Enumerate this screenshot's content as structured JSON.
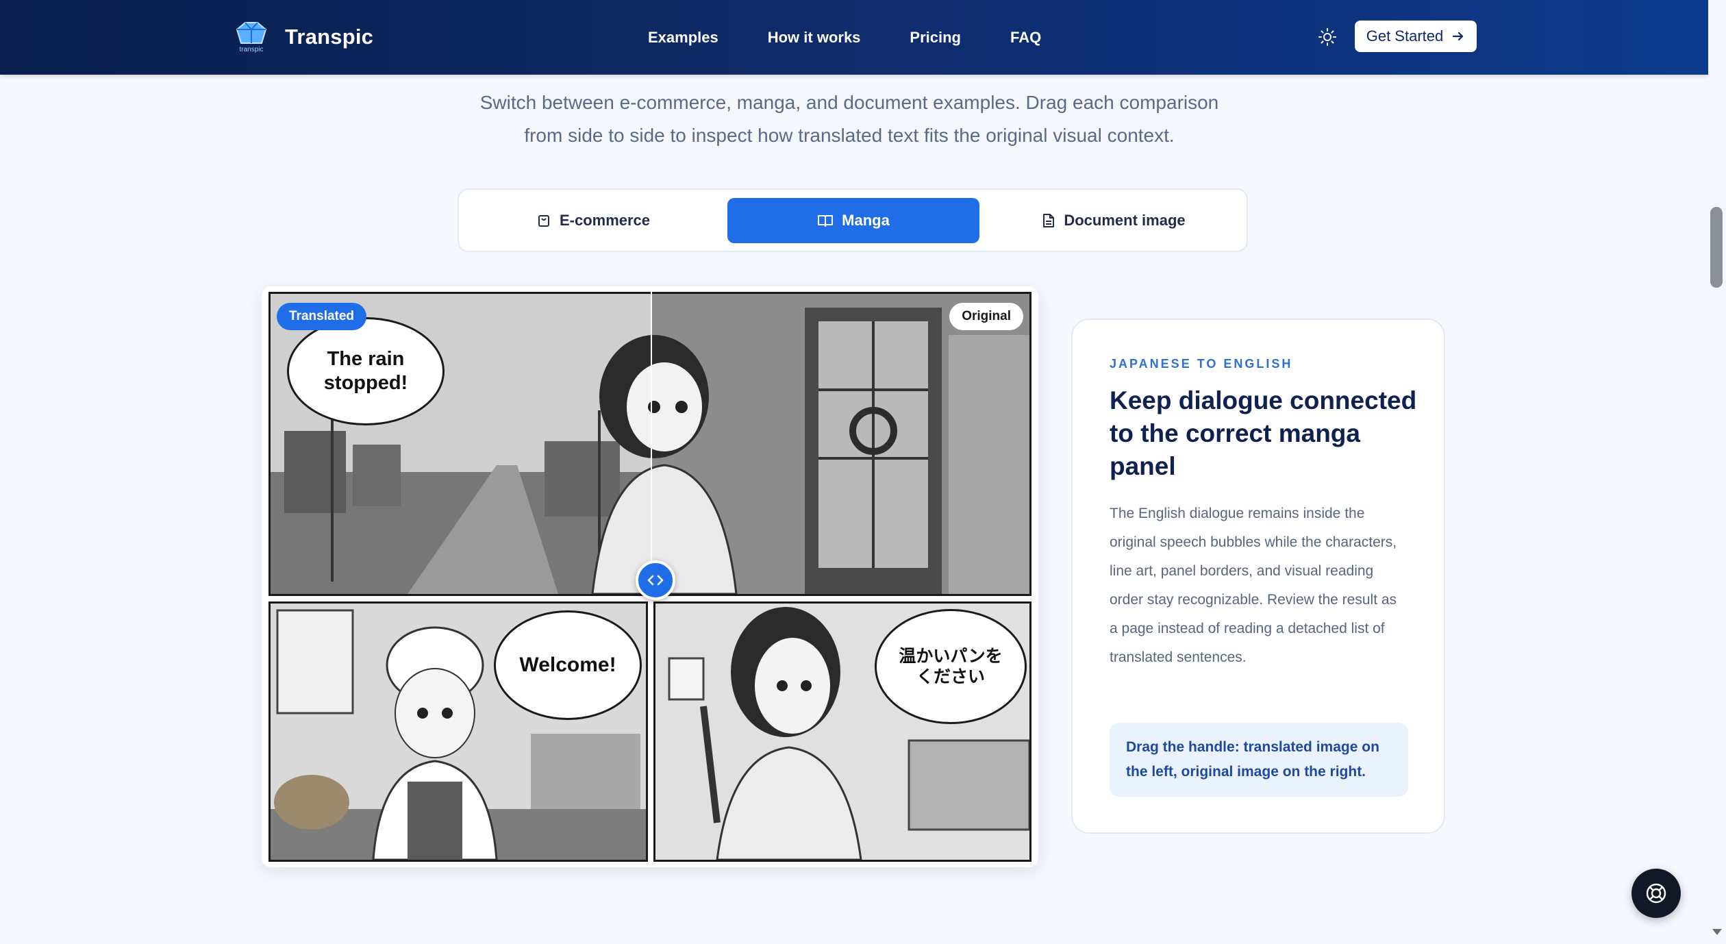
{
  "header": {
    "brand_name": "Transpic",
    "logo_text": "transpic",
    "nav": [
      "Examples",
      "How it works",
      "Pricing",
      "FAQ"
    ],
    "cta_label": "Get Started"
  },
  "intro": {
    "line1": "Switch between e-commerce, manga, and document examples. Drag each comparison",
    "line2": "from side to side to inspect how translated text fits the original visual context."
  },
  "tabs": [
    {
      "label": "E-commerce",
      "icon": "shopping-bag-icon",
      "active": false
    },
    {
      "label": "Manga",
      "icon": "book-open-icon",
      "active": true
    },
    {
      "label": "Document image",
      "icon": "file-text-icon",
      "active": false
    }
  ],
  "comparison": {
    "badge_translated": "Translated",
    "badge_original": "Original",
    "bubble_rain": "The rain stopped!",
    "bubble_welcome": "Welcome!",
    "bubble_japanese": "温かいパンを\nください"
  },
  "card": {
    "eyebrow": "JAPANESE TO ENGLISH",
    "title": "Keep dialogue connected to the correct manga panel",
    "body": "The English dialogue remains inside the original speech bubbles while the characters, line art, panel borders, and visual reading order stay recognizable. Review the result as a page instead of reading a detached list of translated sentences.",
    "hint": "Drag the handle: translated image on the left, original image on the right."
  },
  "colors": {
    "accent": "#1f6ee8",
    "header_start": "#0a1f4d",
    "header_end": "#0d3a8e",
    "eyebrow": "#2f6fd6",
    "hint_bg": "#eaf2fd"
  }
}
